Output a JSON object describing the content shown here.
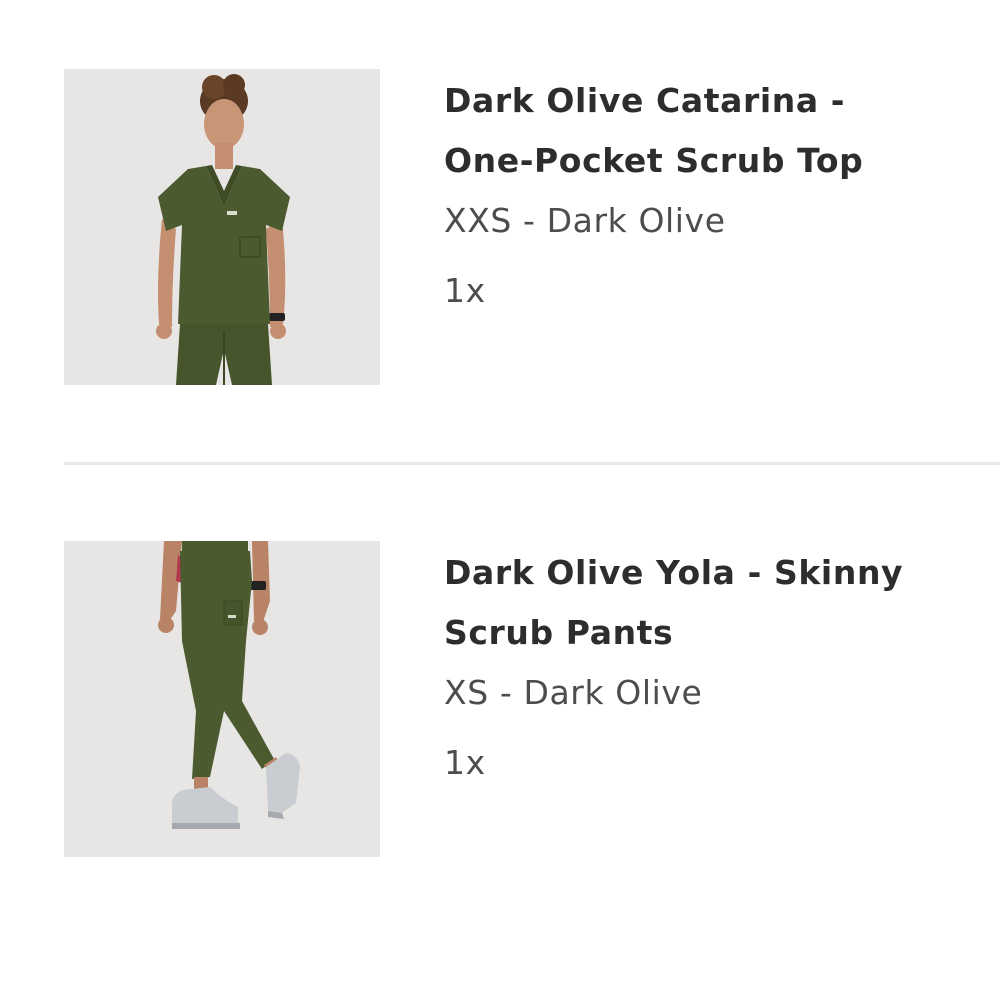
{
  "cart": {
    "items": [
      {
        "title_line1": "Dark Olive Catarina -",
        "title_line2": "One-Pocket Scrub Top",
        "variant": "XXS - Dark Olive",
        "quantity": "1x",
        "image": "model-wearing-scrub-top-photo"
      },
      {
        "title_line1": "Dark Olive Yola - Skinny",
        "title_line2": "Scrub Pants",
        "variant": "XS - Dark Olive",
        "quantity": "1x",
        "image": "model-wearing-scrub-pants-photo"
      }
    ]
  },
  "colors": {
    "product_olive": "#4b5a2f",
    "image_background": "#e6e5e3",
    "divider": "#e9e9e9",
    "title_text": "#2d2d2d",
    "secondary_text": "#4d4d4d"
  }
}
